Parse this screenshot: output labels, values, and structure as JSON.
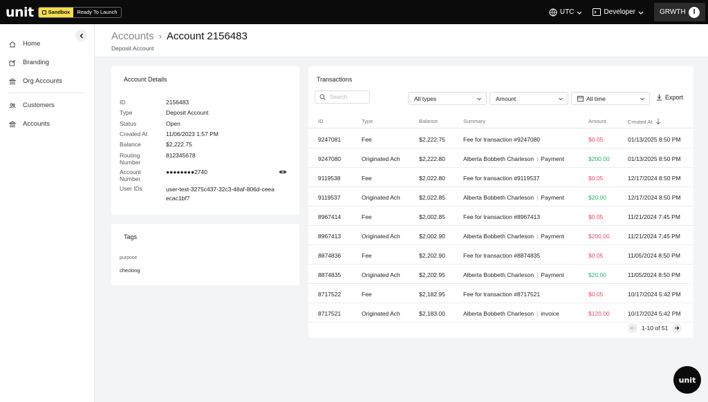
{
  "topbar": {
    "logo": "unit",
    "env_label": "Sandbox",
    "env_status": "Ready To Launch",
    "timezone": "UTC",
    "mode": "Developer",
    "org_name": "GRWTH",
    "org_initial": "I"
  },
  "sidebar": {
    "items": [
      {
        "label": "Home",
        "icon": "home-icon"
      },
      {
        "label": "Branding",
        "icon": "branding-icon"
      },
      {
        "label": "Org Accounts",
        "icon": "bank-icon"
      },
      {
        "label": "Customers",
        "icon": "users-icon"
      },
      {
        "label": "Accounts",
        "icon": "bank-icon"
      }
    ]
  },
  "header": {
    "breadcrumb_parent": "Accounts",
    "breadcrumb_current": "Account 2156483",
    "subtitle": "Deposit Account"
  },
  "account_details": {
    "title": "Account Details",
    "rows": [
      {
        "key": "ID",
        "value": "2156483"
      },
      {
        "key": "Type",
        "value": "Deposit Account"
      },
      {
        "key": "Status",
        "value": "Open"
      },
      {
        "key": "Created At",
        "value": "11/06/2023 1:57 PM"
      },
      {
        "key": "Balance",
        "value": "$2,222.75"
      },
      {
        "key": "Routing Number",
        "value": "812345678"
      },
      {
        "key": "Account Number",
        "value": "●●●●●●●●2740"
      },
      {
        "key": "User IDs",
        "value": "user-test-3275c437-32c3-48af-806d-ceeaecac1bf7"
      }
    ]
  },
  "tags": {
    "title": "Tags",
    "key": "purpose",
    "value": "checking"
  },
  "transactions": {
    "title": "Transactions",
    "search_placeholder": "Search",
    "filter_type": "All types",
    "filter_amount": "Amount",
    "filter_time": "All time",
    "export_label": "Export",
    "columns": [
      "ID",
      "Type",
      "Balance",
      "Summary",
      "Amount",
      "Created At"
    ],
    "rows": [
      {
        "id": "9247081",
        "type": "Fee",
        "balance": "$2,222.75",
        "summary": "Fee for transaction #9247080",
        "tag": "",
        "amount": "$0.05",
        "sign": "neg",
        "created": "01/13/2025 8:50 PM"
      },
      {
        "id": "9247080",
        "type": "Originated Ach",
        "balance": "$2,222.80",
        "summary": "Alberta Bobbeth Charleson",
        "tag": "Payment",
        "amount": "$200.00",
        "sign": "pos",
        "created": "01/13/2025 8:50 PM"
      },
      {
        "id": "9119538",
        "type": "Fee",
        "balance": "$2,022.80",
        "summary": "Fee for transaction #9119537",
        "tag": "",
        "amount": "$0.05",
        "sign": "neg",
        "created": "12/17/2024 8:50 PM"
      },
      {
        "id": "9119537",
        "type": "Originated Ach",
        "balance": "$2,022.85",
        "summary": "Alberta Bobbeth Charleson",
        "tag": "Payment",
        "amount": "$20.00",
        "sign": "pos",
        "created": "12/17/2024 8:50 PM"
      },
      {
        "id": "8967414",
        "type": "Fee",
        "balance": "$2,002.85",
        "summary": "Fee for transaction #8967413",
        "tag": "",
        "amount": "$0.05",
        "sign": "neg",
        "created": "11/21/2024 7:45 PM"
      },
      {
        "id": "8967413",
        "type": "Originated Ach",
        "balance": "$2,002.90",
        "summary": "Alberta Bobbeth Charleson",
        "tag": "Payment",
        "amount": "$200.00",
        "sign": "neg",
        "created": "11/21/2024 7:45 PM"
      },
      {
        "id": "8874836",
        "type": "Fee",
        "balance": "$2,202.90",
        "summary": "Fee for transaction #8874835",
        "tag": "",
        "amount": "$0.05",
        "sign": "neg",
        "created": "11/05/2024 8:50 PM"
      },
      {
        "id": "8874835",
        "type": "Originated Ach",
        "balance": "$2,202.95",
        "summary": "Alberta Bobbeth Charleson",
        "tag": "Payment",
        "amount": "$20.00",
        "sign": "pos",
        "created": "11/05/2024 8:50 PM"
      },
      {
        "id": "8717522",
        "type": "Fee",
        "balance": "$2,182.95",
        "summary": "Fee for transaction #8717521",
        "tag": "",
        "amount": "$0.05",
        "sign": "neg",
        "created": "10/17/2024 5:42 PM"
      },
      {
        "id": "8717521",
        "type": "Originated Ach",
        "balance": "$2,183.00",
        "summary": "Alberta Bobbeth Charleson",
        "tag": "invoice",
        "amount": "$120.00",
        "sign": "neg",
        "created": "10/17/2024 5:42 PM"
      }
    ],
    "pagination": "1-10 of 51"
  },
  "fab_label": "unit",
  "colors": {
    "negative": "#e54b6b",
    "positive": "#27b36a",
    "env_yellow": "#f5dd4b"
  }
}
